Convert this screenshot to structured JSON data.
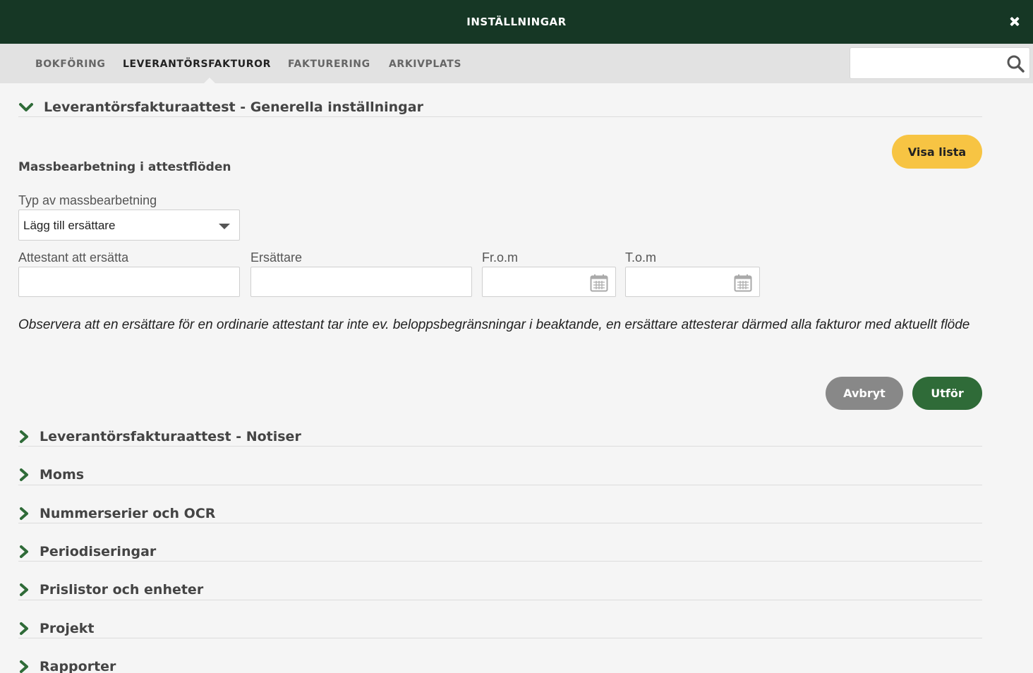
{
  "header": {
    "title": "INSTÄLLNINGAR"
  },
  "tabs": [
    {
      "label": "BOKFÖRING"
    },
    {
      "label": "LEVERANTÖRSFAKTUROR",
      "active": true
    },
    {
      "label": "FAKTURERING"
    },
    {
      "label": "ARKIVPLATS"
    }
  ],
  "search": {
    "value": "",
    "placeholder": ""
  },
  "expanded_section": {
    "title": "Leverantörsfakturaattest - Generella inställningar",
    "subheading": "Massbearbetning i attestflöden",
    "visa_lista_label": "Visa lista",
    "type_label": "Typ av massbearbetning",
    "type_value": "Lägg till ersättare",
    "fields": {
      "attestant_label": "Attestant att ersätta",
      "ersattare_label": "Ersättare",
      "from_label": "Fr.o.m",
      "tom_label": "T.o.m"
    },
    "note": "Observera att en ersättare för en ordinarie attestant tar inte ev. beloppsbegränsningar i beaktande, en ersättare attesterar därmed alla fakturor med aktuellt flöde",
    "cancel_label": "Avbryt",
    "execute_label": "Utför"
  },
  "collapsed_sections": [
    {
      "title": "Leverantörsfakturaattest - Notiser"
    },
    {
      "title": "Moms"
    },
    {
      "title": "Nummerserier och OCR"
    },
    {
      "title": "Periodiseringar"
    },
    {
      "title": "Prislistor och enheter"
    },
    {
      "title": "Projekt"
    },
    {
      "title": "Rapporter"
    }
  ],
  "colors": {
    "header_bg": "#163725",
    "accent_green": "#2f6b38",
    "accent_yellow": "#f7c443",
    "cancel_gray": "#888888"
  },
  "icons": {
    "close": "close-icon",
    "search": "search-icon",
    "calendar": "calendar-icon",
    "chevron_down": "chevron-down-icon",
    "chevron_right": "chevron-right-icon"
  }
}
